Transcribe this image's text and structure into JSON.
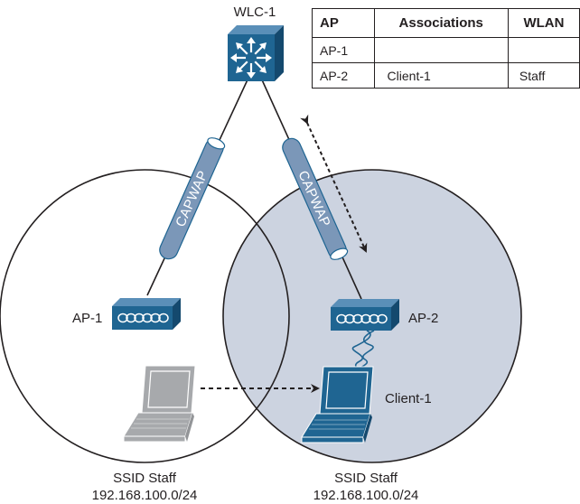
{
  "controller": {
    "label": "WLC-1",
    "icon": "multilayer-switch-icon"
  },
  "tunnels": [
    {
      "label": "CAPWAP",
      "from": "WLC-1",
      "to": "AP-1"
    },
    {
      "label": "CAPWAP",
      "from": "WLC-1",
      "to": "AP-2"
    }
  ],
  "access_points": [
    {
      "label": "AP-1",
      "icon": "access-point-icon"
    },
    {
      "label": "AP-2",
      "icon": "access-point-icon"
    }
  ],
  "clients": [
    {
      "label": "",
      "state": "previous-location",
      "icon": "laptop-icon"
    },
    {
      "label": "Client-1",
      "state": "associated",
      "icon": "laptop-icon"
    }
  ],
  "cells": [
    {
      "ssid": "SSID Staff",
      "subnet": "192.168.100.0/24"
    },
    {
      "ssid": "SSID Staff",
      "subnet": "192.168.100.0/24"
    }
  ],
  "table": {
    "headers": [
      "AP",
      "Associations",
      "WLAN"
    ],
    "rows": [
      [
        "AP-1",
        "",
        ""
      ],
      [
        "AP-2",
        "Client-1",
        "Staff"
      ]
    ]
  },
  "colors": {
    "device_blue": "#1f6592",
    "tunnel_blue": "#7b97b8",
    "cell_fill": "#ccd3e0",
    "ghost_gray": "#a7a9ac",
    "line": "#231f20"
  }
}
